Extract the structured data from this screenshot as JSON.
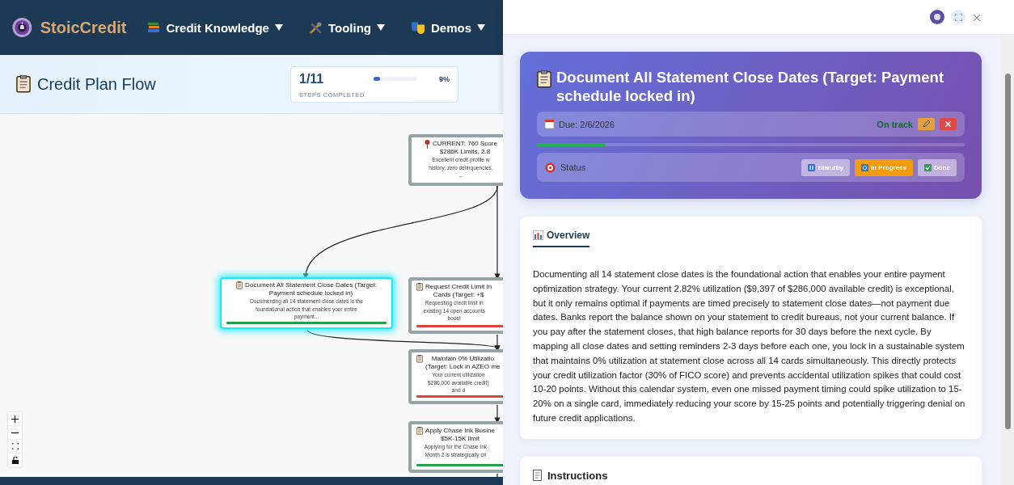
{
  "brand": "StoicCredit",
  "nav": [
    {
      "label": "Credit Knowledge",
      "kind": "books"
    },
    {
      "label": "Tooling",
      "kind": "tools"
    },
    {
      "label": "Demos",
      "kind": "masks"
    }
  ],
  "page_title": "Credit Plan Flow",
  "progress": {
    "count": "1/11",
    "caption": "STEPS COMPLETED",
    "level": 0.09,
    "percent": "9%"
  },
  "nodes": [
    {
      "kind": "current",
      "selected": false,
      "title_lines": [
        "CURRENT: 760 Score",
        "$286K Limits, 2.8"
      ],
      "description_lines": [
        "Excellent credit profile w",
        "history, zero delinquencies,",
        "..."
      ]
    },
    {
      "kind": "step",
      "selected": true,
      "title_lines": [
        "Document All Statement Close Dates (Target:",
        "Payment schedule locked in)"
      ],
      "description_lines": [
        "Documenting all 14 statement close dates is the",
        "foundational action that enables your entire",
        "payment..."
      ],
      "color": "#22a04b"
    },
    {
      "kind": "step",
      "selected": false,
      "title_lines": [
        "Request Credit Limit In",
        "Cards (Target: +$"
      ],
      "description_lines": [
        "Requesting credit limit in",
        "existing 14 open accounts",
        "boost"
      ],
      "color": "#e0413a"
    },
    {
      "kind": "step",
      "selected": false,
      "title_lines": [
        "Maintain 0% Utilizatio",
        "(Target: Lock in AZEO me"
      ],
      "description_lines": [
        "Your current utilization",
        "$286,000 available credit)",
        "and d"
      ],
      "color": "#e0413a"
    },
    {
      "kind": "step",
      "selected": false,
      "title_lines": [
        "Apply Chase Ink Busine",
        "$5K-15K limit"
      ],
      "description_lines": [
        "Applying for the Chase Ink",
        "Month 2 is strategically cri"
      ],
      "color": "#22a04b"
    }
  ],
  "detail": {
    "title": "Document All Statement Close Dates (Target: Payment schedule locked in)",
    "due": "Due: 2/6/2026",
    "track": "On track",
    "level": 0.16,
    "status_label": "Status",
    "statuses": [
      {
        "label": "Standby",
        "kind": "pause",
        "selected": false
      },
      {
        "label": "In Progress",
        "kind": "cycle",
        "selected": true
      },
      {
        "label": "Done",
        "kind": "check",
        "selected": false
      }
    ],
    "overview_tab": "Overview",
    "overview": "Documenting all 14 statement close dates is the foundational action that enables your entire payment optimization strategy. Your current 2.82% utilization ($9,397 of $286,000 available credit) is exceptional, but it only remains optimal if payments are timed precisely to statement close dates—not payment due dates. Banks report the balance shown on your statement to credit bureaus, not your current balance. If you pay after the statement closes, that high balance reports for 30 days before the next cycle. By mapping all close dates and setting reminders 2-3 days before each one, you lock in a sustainable system that maintains 0% utilization at statement close across all 14 cards simultaneously. This directly protects your credit utilization factor (30% of FICO score) and prevents accidental utilization spikes that could cost 10-20 points. Without this calendar system, even one missed payment timing could spike utilization to 15-20% on a single card, immediately reducing your score by 15-25 points and potentially triggering denial on future credit applications.",
    "instructions_title": "Instructions"
  }
}
